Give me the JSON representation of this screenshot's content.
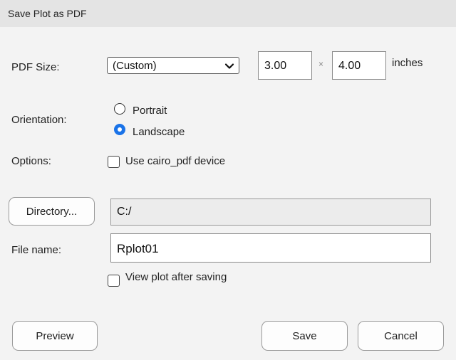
{
  "window": {
    "title": "Save Plot as PDF"
  },
  "pdf_size": {
    "label": "PDF Size:",
    "selected": "(Custom)",
    "width": "3.00",
    "times": "×",
    "height": "4.00",
    "unit": "inches"
  },
  "orientation": {
    "label": "Orientation:",
    "options": [
      "Portrait",
      "Landscape"
    ],
    "selected": "Landscape"
  },
  "options": {
    "label": "Options:",
    "cairo_label": "Use cairo_pdf device",
    "cairo_checked": false
  },
  "directory": {
    "button_label": "Directory...",
    "value": "C:/"
  },
  "file": {
    "label": "File name:",
    "value": "Rplot01"
  },
  "view_after": {
    "label": "View plot after saving",
    "checked": false
  },
  "buttons": {
    "preview": "Preview",
    "save": "Save",
    "cancel": "Cancel"
  },
  "colors": {
    "accent": "#1a73e8",
    "background": "#f3f3f3",
    "titlebar": "#e4e4e4"
  },
  "icons": {
    "select_arrow": "chevron-down-icon"
  }
}
